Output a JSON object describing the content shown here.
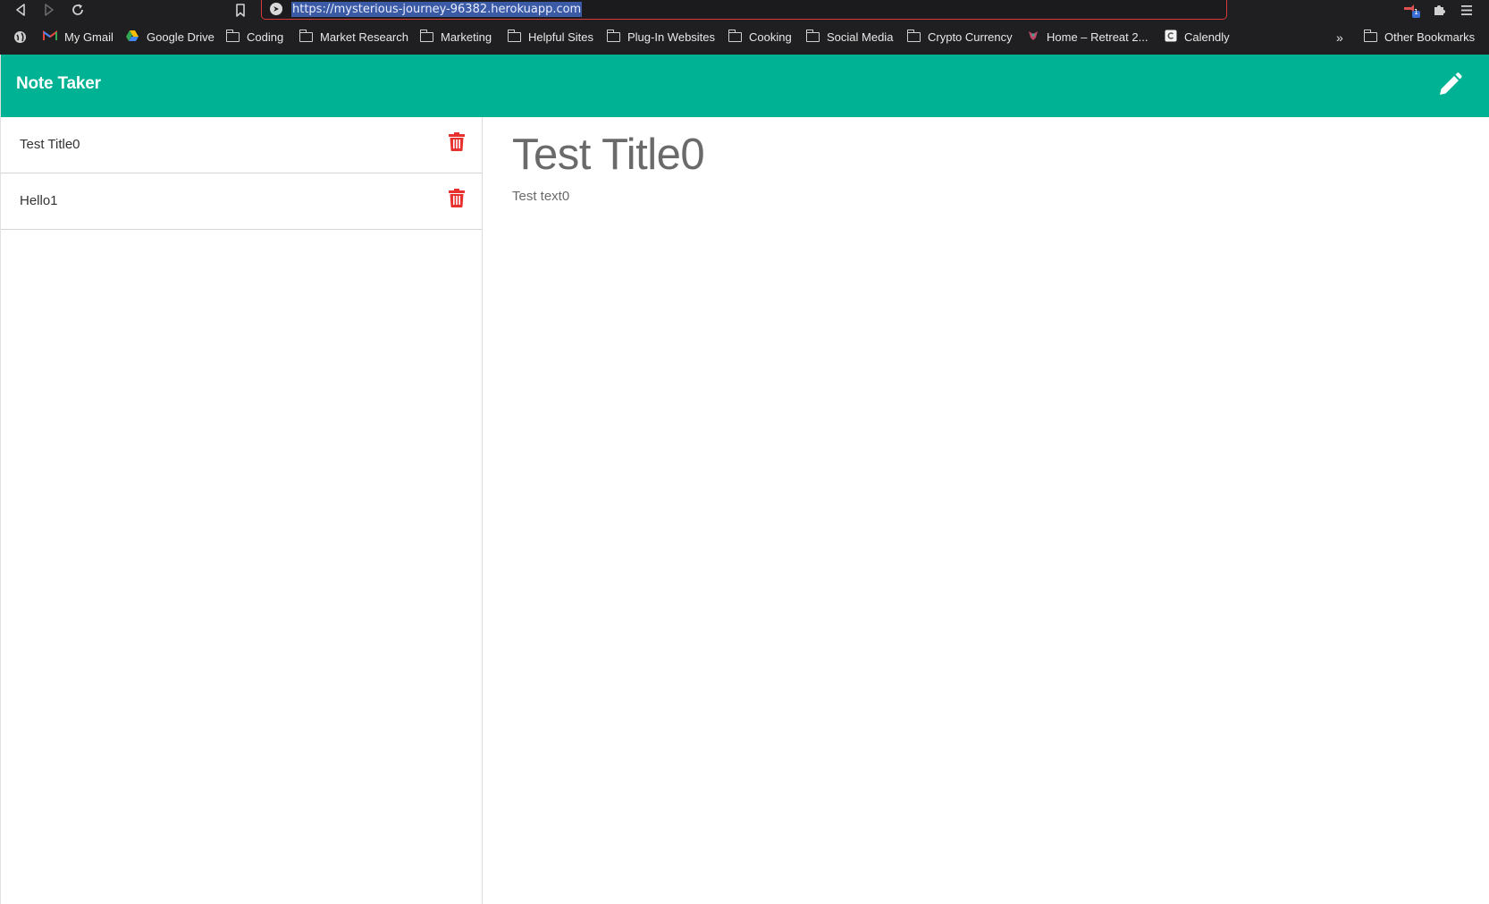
{
  "browser": {
    "url": "https://mysterious-journey-96382.herokuapp.com",
    "extension_badge": "1",
    "bookmarks": [
      {
        "label": "My Gmail",
        "icon": "gmail-icon"
      },
      {
        "label": "Google Drive",
        "icon": "google-drive-icon"
      },
      {
        "label": "Coding",
        "icon": "folder-icon"
      },
      {
        "label": "Market Research",
        "icon": "folder-icon"
      },
      {
        "label": "Marketing",
        "icon": "folder-icon"
      },
      {
        "label": "Helpful Sites",
        "icon": "folder-icon"
      },
      {
        "label": "Plug-In Websites",
        "icon": "folder-icon"
      },
      {
        "label": "Cooking",
        "icon": "folder-icon"
      },
      {
        "label": "Social Media",
        "icon": "folder-icon"
      },
      {
        "label": "Crypto Currency",
        "icon": "folder-icon"
      },
      {
        "label": "Home – Retreat 2...",
        "icon": "site-icon"
      },
      {
        "label": "Calendly",
        "icon": "calendly-icon"
      }
    ],
    "overflow_label": "»",
    "other_bookmarks": "Other Bookmarks"
  },
  "app": {
    "brand": "Note Taker",
    "colors": {
      "navbar": "#00b294",
      "trash": "#e8312f"
    },
    "notes": [
      {
        "title": "Test Title0"
      },
      {
        "title": "Hello1"
      }
    ],
    "active_note": {
      "title": "Test Title0",
      "text": "Test text0"
    }
  }
}
